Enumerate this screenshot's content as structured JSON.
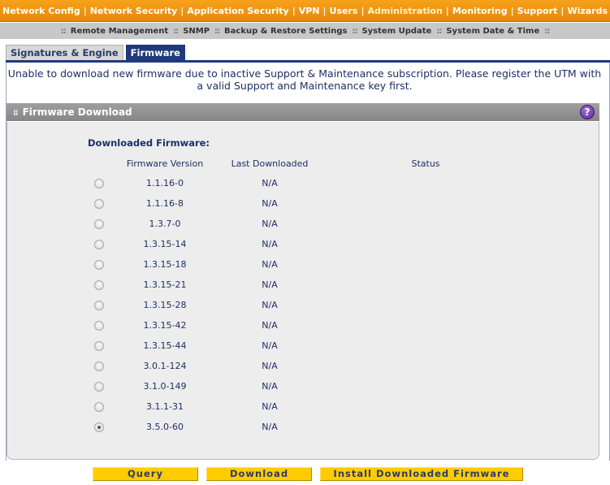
{
  "topnav": {
    "items": [
      {
        "label": "Network Config"
      },
      {
        "label": "Network Security"
      },
      {
        "label": "Application Security"
      },
      {
        "label": "VPN"
      },
      {
        "label": "Users"
      },
      {
        "label": "Administration"
      },
      {
        "label": "Monitoring"
      },
      {
        "label": "Support"
      },
      {
        "label": "Wizards"
      }
    ],
    "active": "Administration",
    "separator": "|"
  },
  "subnav": {
    "items": [
      {
        "label": "Remote Management"
      },
      {
        "label": "SNMP"
      },
      {
        "label": "Backup & Restore Settings"
      },
      {
        "label": "System Update"
      },
      {
        "label": "System Date & Time"
      }
    ],
    "separator": "::",
    "active": "System Update"
  },
  "tabs": [
    {
      "label": "Signatures & Engine",
      "active": false
    },
    {
      "label": "Firmware",
      "active": true
    }
  ],
  "message": "Unable to download new firmware due to inactive Support & Maintenance subscription. Please register the UTM with a valid Support and Maintenance key first.",
  "section": {
    "title": "Firmware Download",
    "help_icon": "question-icon",
    "help_label": "?"
  },
  "downloaded": {
    "title": "Downloaded Firmware:",
    "columns": [
      "Firmware Version",
      "Last Downloaded",
      "Status"
    ],
    "rows": [
      {
        "version": "1.1.16-0",
        "last": "N/A",
        "status": "",
        "selected": false
      },
      {
        "version": "1.1.16-8",
        "last": "N/A",
        "status": "",
        "selected": false
      },
      {
        "version": "1.3.7-0",
        "last": "N/A",
        "status": "",
        "selected": false
      },
      {
        "version": "1.3.15-14",
        "last": "N/A",
        "status": "",
        "selected": false
      },
      {
        "version": "1.3.15-18",
        "last": "N/A",
        "status": "",
        "selected": false
      },
      {
        "version": "1.3.15-21",
        "last": "N/A",
        "status": "",
        "selected": false
      },
      {
        "version": "1.3.15-28",
        "last": "N/A",
        "status": "",
        "selected": false
      },
      {
        "version": "1.3.15-42",
        "last": "N/A",
        "status": "",
        "selected": false
      },
      {
        "version": "1.3.15-44",
        "last": "N/A",
        "status": "",
        "selected": false
      },
      {
        "version": "3.0.1-124",
        "last": "N/A",
        "status": "",
        "selected": false
      },
      {
        "version": "3.1.0-149",
        "last": "N/A",
        "status": "",
        "selected": false
      },
      {
        "version": "3.1.1-31",
        "last": "N/A",
        "status": "",
        "selected": false
      },
      {
        "version": "3.5.0-60",
        "last": "N/A",
        "status": "",
        "selected": true
      }
    ]
  },
  "buttons": {
    "query": "Query",
    "download": "Download",
    "install": "Install Downloaded Firmware"
  },
  "colors": {
    "nav_orange": "#f7a21a",
    "tab_active": "#1f3a7a",
    "button_yellow": "#ffcc00",
    "text_navy": "#1f2f66"
  }
}
